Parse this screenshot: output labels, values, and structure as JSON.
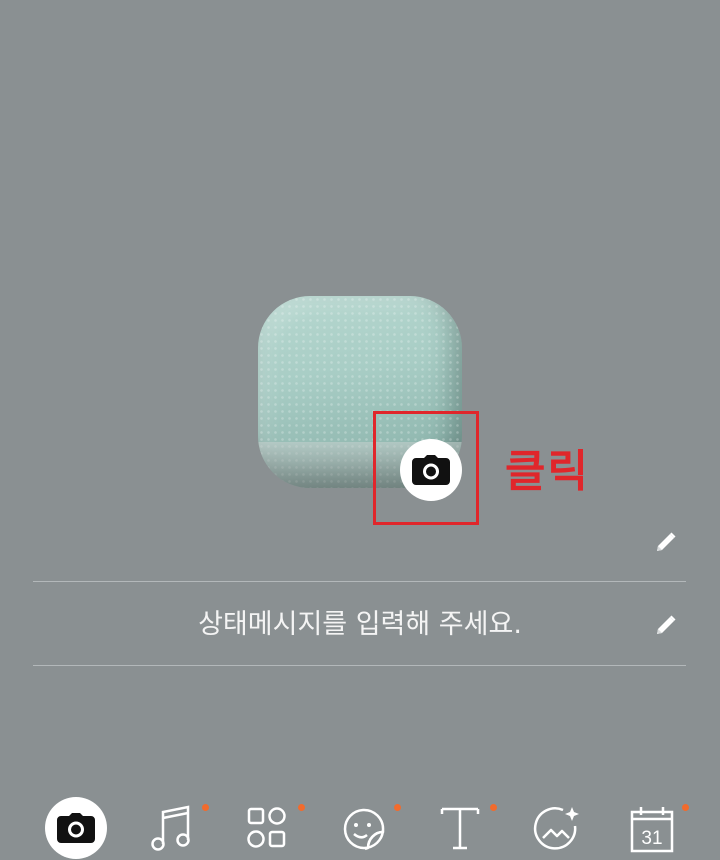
{
  "profile": {
    "photo_alt": ""
  },
  "annotation": {
    "label": "클릭",
    "color": "#e0262b"
  },
  "status_message": {
    "placeholder": "상태메시지를 입력해 주세요."
  },
  "toolbar": {
    "items": [
      {
        "icon": "camera-icon",
        "active": true,
        "has_dot": false
      },
      {
        "icon": "music-note-icon",
        "active": false,
        "has_dot": true
      },
      {
        "icon": "widgets-icon",
        "active": false,
        "has_dot": true
      },
      {
        "icon": "sticker-icon",
        "active": false,
        "has_dot": true
      },
      {
        "icon": "text-icon",
        "active": false,
        "has_dot": true
      },
      {
        "icon": "photo-filter-icon",
        "active": false,
        "has_dot": false
      },
      {
        "icon": "calendar-icon",
        "active": false,
        "has_dot": true,
        "label": "31"
      }
    ]
  },
  "colors": {
    "background": "#8a9092",
    "accent_dot": "#f26b2c",
    "text": "#f4f4f4"
  }
}
